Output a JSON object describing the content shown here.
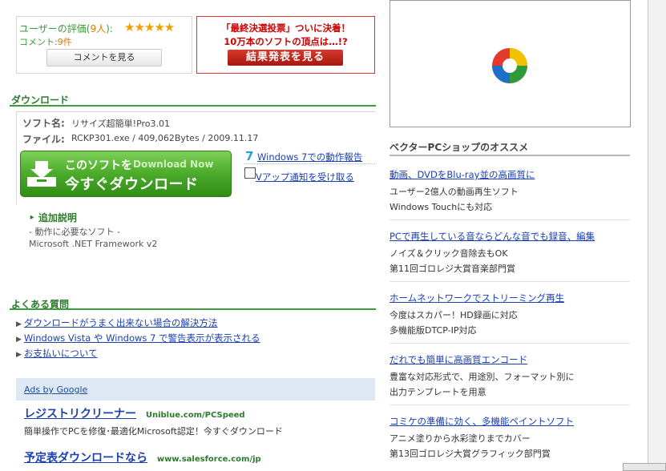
{
  "rating": {
    "label_prefix": "ユーザーの評価(",
    "count": "9人",
    "label_suffix": "):",
    "stars": "★★★★★",
    "comment_prefix": "コメント:",
    "comment_count": "9件",
    "comment_button": "コメントを見る"
  },
  "vote": {
    "line1": "「最終決選投票」ついに決着！",
    "line2": "10万本のソフトの頂点は…!?",
    "button": "結果発表を見る"
  },
  "download": {
    "heading": "ダウンロード",
    "software_label": "ソフト名:",
    "software_value": "リサイズ超簡単!Pro3.01",
    "file_label": "ファイル:",
    "file_value": "RCKP301.exe / 409,062Bytes / 2009.11.17",
    "button_line1": "このソフトを",
    "button_line1_en": "Download Now",
    "button_line2": "今すぐダウンロード",
    "win7_mark": "7",
    "win7_link": "Windows 7での動作報告",
    "vup_link": "Vアップ通知を受け取る"
  },
  "extra": {
    "heading": "‣ 追加説明",
    "line1": "- 動作に必要なソフト -",
    "line2": "Microsoft .NET Framework v2"
  },
  "faq": {
    "heading": "よくある質問",
    "items": [
      "ダウンロードがうまく出来ない場合の解決方法",
      "Windows Vista や Windows 7 で警告表示が表示される",
      "お支払いについて"
    ]
  },
  "ads": {
    "label": "Ads by Google",
    "items": [
      {
        "title": "レジストリクリーナー",
        "url": "Uniblue.com/PCSpeed",
        "desc": "簡単操作でPCを修復･最適化Microsoft認定！今すぐダウンロード"
      },
      {
        "title": "予定表ダウンロードなら",
        "url": "www.salesforce.com/jp",
        "desc": ""
      }
    ]
  },
  "shop": {
    "heading": "ベクターPCショップのオススメ",
    "items": [
      {
        "link": "動画、DVDをBlu-ray並の高画質に",
        "desc1": "ユーザー2億人の動画再生ソフト",
        "desc2": "Windows Touchにも対応"
      },
      {
        "link": "PCで再生している音ならどんな音でも録音、編集",
        "desc1": "ノイズ＆クリック音除去もOK",
        "desc2": "第11回ゴロレジ大賞音楽部門賞"
      },
      {
        "link": "ホームネットワークでストリーミング再生",
        "desc1": "今度はスカパー！HD録画に対応",
        "desc2": "多機能版DTCP-IP対応"
      },
      {
        "link": "だれでも簡単に高画質エンコード",
        "desc1": "豊富な対応形式で、用途別、フォーマット別に",
        "desc2": "出力テンプレートを用意"
      },
      {
        "link": "コミケの準備に効く、多機能ペイントソフト",
        "desc1": "アニメ塗りから水彩塗りまでカバー",
        "desc2": "第13回ゴロレジ大賞グラフィック部門賞"
      }
    ]
  },
  "colors": {
    "green_accent": "#3e9c3e",
    "link_blue": "#1a3fb0",
    "vote_red": "#c00000",
    "star_orange": "#f2a000"
  }
}
